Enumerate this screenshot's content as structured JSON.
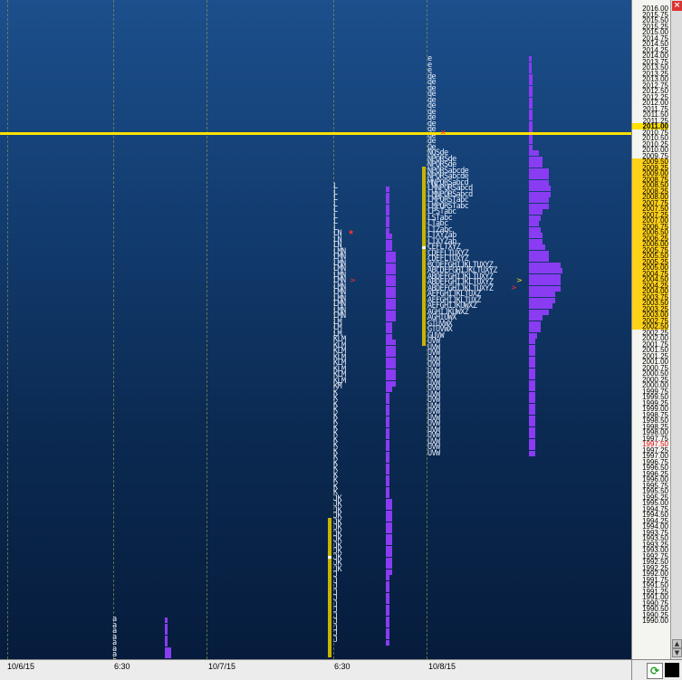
{
  "x_axis": {
    "labels": [
      "10/6/15",
      "6:30",
      "10/7/15",
      "6:30",
      "10/8/15"
    ]
  },
  "y_axis": {
    "labels": [
      "2016.00",
      "2015.75",
      "2015.50",
      "2015.25",
      "2015.00",
      "2014.75",
      "2014.50",
      "2014.25",
      "2014.00",
      "2013.75",
      "2013.50",
      "2013.25",
      "2013.00",
      "2012.75",
      "2012.50",
      "2012.25",
      "2012.00",
      "2011.75",
      "2011.50",
      "2011.25",
      "2011.00",
      "2010.75",
      "2010.50",
      "2010.25",
      "2010.00",
      "2009.75",
      "2009.50",
      "2009.25",
      "2009.00",
      "2008.75",
      "2008.50",
      "2008.25",
      "2008.00",
      "2007.75",
      "2007.50",
      "2007.25",
      "2007.00",
      "2006.75",
      "2006.50",
      "2006.25",
      "2006.00",
      "2005.75",
      "2005.50",
      "2005.25",
      "2005.00",
      "2004.75",
      "2004.50",
      "2004.25",
      "2004.00",
      "2003.75",
      "2003.50",
      "2003.25",
      "2003.00",
      "2002.75",
      "2002.50",
      "2002.25",
      "2002.00",
      "2001.75",
      "2001.50",
      "2001.25",
      "2001.00",
      "2000.75",
      "2000.50",
      "2000.25",
      "2000.00",
      "1999.75",
      "1999.50",
      "1999.25",
      "1999.00",
      "1998.75",
      "1998.50",
      "1998.25",
      "1998.00",
      "1997.75",
      "1997.50",
      "1997.25",
      "1997.00",
      "1996.75",
      "1996.50",
      "1996.25",
      "1996.00",
      "1995.75",
      "1995.50",
      "1995.25",
      "1995.00",
      "1994.75",
      "1994.50",
      "1994.25",
      "1994.00",
      "1993.75",
      "1993.50",
      "1993.25",
      "1993.00",
      "1992.75",
      "1992.50",
      "1992.25",
      "1992.00",
      "1991.75",
      "1991.50",
      "1991.25",
      "1991.00",
      "1990.75",
      "1990.50",
      "1990.25",
      "1990.00"
    ],
    "current_price": "2011.00",
    "red_price": "1997.50",
    "value_area": [
      "2009.50",
      "2002.50"
    ]
  },
  "colors": {
    "poc_line": "#ffe100",
    "histogram": "#8a3cf2",
    "value_area_bar": "#c8b400",
    "highlight": "#ffd21a",
    "alert": "#e10000"
  },
  "profiles": {
    "day1_left": {
      "start_price": "1990.75",
      "rows": [
        "a",
        "a",
        "a",
        "a",
        "a",
        "a",
        "a",
        "a",
        "a",
        "a",
        "a",
        "a",
        "a"
      ]
    },
    "day2": {
      "rows": [
        "L",
        "L",
        "L",
        "L",
        "L",
        "L",
        "L",
        "L",
        "LN",
        "LN",
        "LN",
        "LMN",
        "LMN",
        "LMN",
        "LMN",
        "LMN",
        "LMN",
        "LMN",
        "LMN",
        "LMN",
        "LMN",
        "LMN",
        "LMN",
        "LM",
        "LM",
        "LM",
        "KLM",
        "KLM",
        "KLM",
        "KLM",
        "KLM",
        "KLM",
        "KLM",
        "KLM",
        "KM",
        "K",
        "K",
        "K",
        "K",
        "K",
        "K",
        "K",
        "K",
        "K",
        "K",
        "K",
        "K",
        "K",
        "K",
        "K",
        "K",
        "K",
        "K",
        "JK",
        "JK",
        "JK",
        "JK",
        "JK",
        "JK",
        "JK",
        "JK",
        "JK",
        "JK",
        "JK",
        "JK",
        "JK",
        "J",
        "J",
        "J",
        "J",
        "J",
        "J",
        "J",
        "J",
        "J",
        "J",
        "J",
        "J"
      ]
    },
    "day3": {
      "rows": [
        "e",
        "e",
        "e",
        "de",
        "de",
        "de",
        "de",
        "de",
        "de",
        "de",
        "de",
        "de",
        "de",
        "de",
        "de",
        "Qe",
        "NQSde",
        "NPQRSde",
        "NPQRSde",
        "NPQRSabcde",
        "NPQRSabcde",
        "MNPQRSabcd",
        "LMNPQRSabcd",
        "LMNPQRSabcd",
        "LMPQRSTabc",
        "LMPQRSTabc",
        "LPSTabc",
        "LSTabc",
        "LTabc",
        "LTZabc",
        "LTXYZab",
        "LTXYZab",
        "CEFLTXYZ",
        "CDEFLTUXYZ",
        "CDEFLTUXYZ",
        "BCDEFGHIJKLTUXYZ",
        "ABCDEFGHIJKLTUXYZ",
        "ABDEFGHIJKLTUXYZ",
        "ABDEFGHIJKLTUXYZ",
        "ABDEFGHIJKLTUXYZ",
        "AEFGHIJKLTUXZ",
        "AEFGHIJKLTUXZ",
        "AEFGHIJKUWXZ",
        "AGHIJKUWXZ",
        "AGHIUWX",
        "GTUVWX",
        "GTUVWX",
        "GUVW",
        "UVW",
        "UVW",
        "UVW",
        "UVW",
        "UVW",
        "UVW",
        "UVW",
        "UVW",
        "UVW",
        "UVW",
        "UVW",
        "UVW",
        "UVW",
        "UVW",
        "UVW",
        "UVW",
        "UVW",
        "UVW",
        "UVW",
        "UVW"
      ]
    }
  }
}
